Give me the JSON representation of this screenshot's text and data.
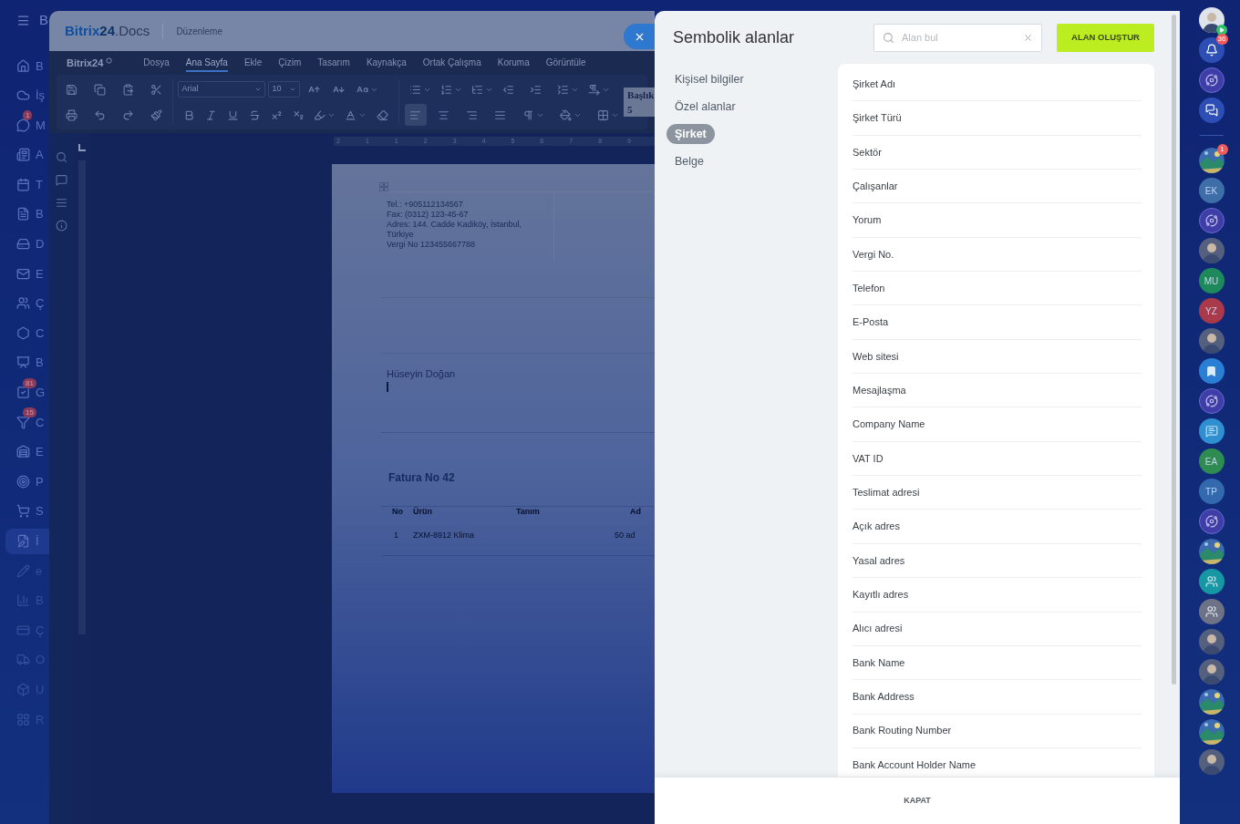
{
  "app_nav": {
    "title_letter": "B",
    "items": [
      {
        "label": "B",
        "selected": false
      },
      {
        "label": "İş",
        "selected": false
      },
      {
        "label": "M",
        "badge": "1",
        "selected": false
      },
      {
        "label": "A",
        "selected": false
      },
      {
        "label": "T",
        "selected": false
      },
      {
        "label": "B",
        "selected": false
      },
      {
        "label": "D",
        "selected": false
      },
      {
        "label": "E",
        "selected": false
      },
      {
        "label": "Ç",
        "selected": false
      },
      {
        "label": "C",
        "selected": false
      },
      {
        "label": "B",
        "selected": false
      },
      {
        "label": "G",
        "badge": "81",
        "selected": false
      },
      {
        "label": "C",
        "badge": "15",
        "selected": false
      },
      {
        "label": "E",
        "selected": false
      },
      {
        "label": "P",
        "selected": false
      },
      {
        "label": "S",
        "selected": false
      },
      {
        "label": "İ",
        "selected": true
      },
      {
        "label": "e",
        "selected": false
      },
      {
        "label": "B",
        "selected": false
      },
      {
        "label": "Ç",
        "selected": false
      },
      {
        "label": "O",
        "selected": false
      },
      {
        "label": "U",
        "selected": false
      },
      {
        "label": "R",
        "selected": false
      }
    ]
  },
  "editor": {
    "logo": {
      "name": "Bitrix",
      "number": "24",
      "suffix": ".Docs"
    },
    "mode": "Düzenleme",
    "menu_logo": "Bitrix24",
    "menu_tabs": [
      {
        "label": "Dosya",
        "selected": false
      },
      {
        "label": "Ana Sayfa",
        "selected": true
      },
      {
        "label": "Ekle",
        "selected": false
      },
      {
        "label": "Çizim",
        "selected": false
      },
      {
        "label": "Tasarım",
        "selected": false
      },
      {
        "label": "Kaynakça",
        "selected": false
      },
      {
        "label": "Ortak Çalışma",
        "selected": false
      },
      {
        "label": "Koruma",
        "selected": false
      },
      {
        "label": "Görüntüle",
        "selected": false
      }
    ],
    "font": "Arial",
    "font_size": "10",
    "style": "Başlık 5",
    "alignment": [
      {
        "selected": true
      },
      {
        "selected": false
      },
      {
        "selected": false
      },
      {
        "selected": false
      }
    ]
  },
  "document": {
    "ruler": [
      "2",
      "1",
      "1",
      "2",
      "3",
      "4",
      "5",
      "6",
      "7",
      "8",
      "9"
    ],
    "contact_lines": [
      "Tel.: +905112134567",
      "Fax: (0312) 123-45-67",
      "Adres: 144. Cadde Kadiköy, İstanbul, Türkiye",
      "Vergi No 123455667788"
    ],
    "signature": "Hüseyin Doğan",
    "invoice_title": "Fatura No 42",
    "table": {
      "columns": [
        "No",
        "Ürün",
        "Tanım",
        "Ad"
      ],
      "rows": [
        {
          "no": "1",
          "product": "ZXM-8912 Klima",
          "column_4": "50 ad"
        }
      ]
    }
  },
  "panel": {
    "title": "Sembolik alanlar",
    "search": {
      "placeholder": "Alan bul"
    },
    "create_button": "ALAN OLUŞTUR",
    "categories": [
      {
        "label": "Kişisel bilgiler",
        "selected": false
      },
      {
        "label": "Özel alanlar",
        "selected": false
      },
      {
        "label": "Şirket",
        "selected": true
      },
      {
        "label": "Belge",
        "selected": false
      }
    ],
    "fields": [
      "Şirket Adı",
      "Şirket Türü",
      "Sektör",
      "Çalışanlar",
      "Yorum",
      "Vergi No.",
      "Telefon",
      "E-Posta",
      "Web sitesi",
      "Mesajlaşma",
      "Company Name",
      "VAT ID",
      "Teslimat adresi",
      "Açık adres",
      "Yasal adres",
      "Kayıtlı adres",
      "Alıcı adresi",
      "Bank Name",
      "Bank Address",
      "Bank Routing Number",
      "Bank Account Holder Name"
    ],
    "close_button": "KAPAT"
  },
  "right_bar": [
    {
      "kind": "self"
    },
    {
      "kind": "bell",
      "badge": "36"
    },
    {
      "kind": "copilot"
    },
    {
      "kind": "messenger"
    },
    {
      "kind": "picture",
      "badge": "1"
    },
    {
      "kind": "initials",
      "text": "EK",
      "color": "#3d6ea8"
    },
    {
      "kind": "copilot"
    },
    {
      "kind": "avatar"
    },
    {
      "kind": "initials",
      "text": "MU",
      "color": "#1e8a5c"
    },
    {
      "kind": "initials",
      "text": "YZ",
      "color": "#a83a4c"
    },
    {
      "kind": "avatar"
    },
    {
      "kind": "bookmark"
    },
    {
      "kind": "copilot"
    },
    {
      "kind": "chat"
    },
    {
      "kind": "initials",
      "text": "EA",
      "color": "#2e8c52"
    },
    {
      "kind": "initials",
      "text": "TP",
      "color": "#3369ad"
    },
    {
      "kind": "copilot"
    },
    {
      "kind": "picture"
    },
    {
      "kind": "users",
      "color": "#1797a3"
    },
    {
      "kind": "users",
      "color": "#6d7385"
    },
    {
      "kind": "avatar"
    },
    {
      "kind": "avatar"
    },
    {
      "kind": "picture"
    },
    {
      "kind": "picture"
    },
    {
      "kind": "avatar"
    }
  ]
}
